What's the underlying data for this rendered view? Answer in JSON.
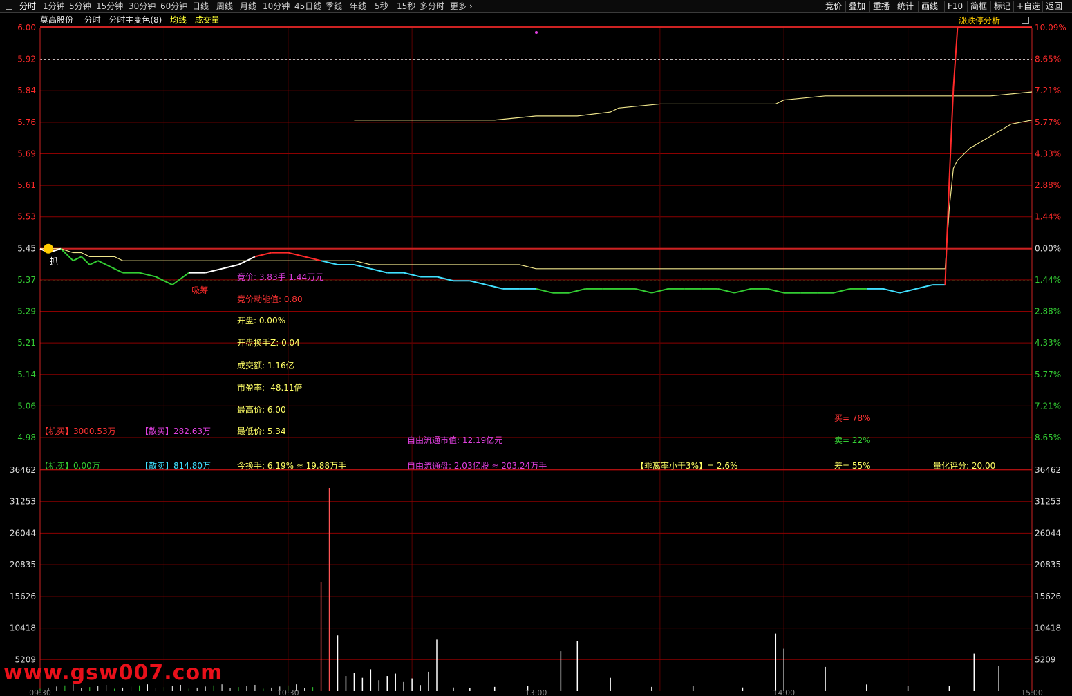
{
  "toolbar": {
    "tabs": [
      "分时",
      "1分钟",
      "5分钟",
      "15分钟",
      "30分钟",
      "60分钟",
      "日线",
      "周线",
      "月线",
      "10分钟",
      "45日线",
      "季线",
      "年线",
      "5秒",
      "15秒",
      "多分时",
      "更多"
    ],
    "active_tab": "分时",
    "right_buttons": [
      "竞价",
      "叠加",
      "重播",
      "统计",
      "画线",
      "F10",
      "简框",
      "标记",
      "+自选",
      "返回"
    ]
  },
  "header": {
    "stock_name": "莫高股份",
    "view": "分时",
    "indicator": "分时主变色(8)",
    "avg_label": "均线",
    "vol_label": "成交量",
    "analysis_button": "涨跌停分析"
  },
  "colors": {
    "up": "#ff2a2a",
    "down": "#33cc33",
    "price_line": "#ffffff",
    "avg_line": "#f0e68c",
    "grid": "#8b0000",
    "magenta": "#e040e0",
    "yellow": "#ffff66",
    "cyan": "#40e0ff"
  },
  "chart_data": [
    {
      "type": "line",
      "title": "分时",
      "y_ticks": [
        "6.00",
        "5.92",
        "5.84",
        "5.76",
        "5.69",
        "5.61",
        "5.53",
        "5.45",
        "5.37",
        "5.29",
        "5.21",
        "5.14",
        "5.06",
        "4.98"
      ],
      "pct_ticks": [
        "10.09%",
        "8.65%",
        "7.21%",
        "5.77%",
        "4.33%",
        "2.88%",
        "1.44%",
        "0.00%",
        "1.44%",
        "2.88%",
        "4.33%",
        "5.77%",
        "7.21%",
        "8.65%"
      ],
      "ylim": [
        4.98,
        6.0
      ],
      "prev_close": 5.45,
      "x": [
        0,
        2,
        5,
        8,
        10,
        12,
        14,
        16,
        18,
        20,
        24,
        28,
        32,
        36,
        40,
        44,
        48,
        52,
        56,
        60,
        64,
        68,
        72,
        76,
        80,
        84,
        88,
        92,
        96,
        100,
        104,
        108,
        112,
        116,
        120,
        124,
        128,
        132,
        136,
        140,
        144,
        148,
        152,
        156,
        160,
        164,
        168,
        172,
        176,
        180,
        184,
        188,
        192,
        196,
        200,
        204,
        208,
        212,
        216,
        219,
        220,
        221,
        222,
        225,
        230,
        235,
        240
      ],
      "series": [
        {
          "name": "价格",
          "values": [
            5.45,
            5.44,
            5.45,
            5.42,
            5.43,
            5.41,
            5.42,
            5.41,
            5.4,
            5.39,
            5.39,
            5.38,
            5.36,
            5.39,
            5.39,
            5.4,
            5.41,
            5.43,
            5.44,
            5.44,
            5.43,
            5.42,
            5.41,
            5.41,
            5.4,
            5.39,
            5.39,
            5.38,
            5.38,
            5.37,
            5.37,
            5.36,
            5.35,
            5.35,
            5.35,
            5.34,
            5.34,
            5.35,
            5.35,
            5.35,
            5.35,
            5.34,
            5.35,
            5.35,
            5.35,
            5.35,
            5.34,
            5.35,
            5.35,
            5.34,
            5.34,
            5.34,
            5.34,
            5.35,
            5.35,
            5.35,
            5.34,
            5.35,
            5.36,
            5.36,
            5.62,
            5.85,
            6.0,
            6.0,
            6.0,
            6.0,
            6.0
          ]
        },
        {
          "name": "均线",
          "values": [
            5.45,
            5.45,
            5.45,
            5.44,
            5.44,
            5.43,
            5.43,
            5.43,
            5.43,
            5.42,
            5.42,
            5.42,
            5.42,
            5.42,
            5.42,
            5.42,
            5.42,
            5.42,
            5.42,
            5.42,
            5.42,
            5.42,
            5.42,
            5.42,
            5.41,
            5.41,
            5.41,
            5.41,
            5.41,
            5.41,
            5.41,
            5.41,
            5.41,
            5.41,
            5.4,
            5.4,
            5.4,
            5.4,
            5.4,
            5.4,
            5.4,
            5.4,
            5.4,
            5.4,
            5.4,
            5.4,
            5.4,
            5.4,
            5.4,
            5.4,
            5.4,
            5.4,
            5.4,
            5.4,
            5.4,
            5.4,
            5.4,
            5.4,
            5.4,
            5.4,
            5.55,
            5.65,
            5.67,
            5.7,
            5.73,
            5.76,
            5.77
          ]
        }
      ],
      "avg_after": {
        "x": [
          76,
          90,
          100,
          110,
          120,
          130,
          138,
          140,
          150,
          160,
          170,
          178,
          180,
          190,
          200,
          210,
          220,
          226,
          230,
          240
        ],
        "values": [
          5.77,
          5.77,
          5.77,
          5.77,
          5.78,
          5.78,
          5.79,
          5.8,
          5.81,
          5.81,
          5.81,
          5.81,
          5.82,
          5.83,
          5.83,
          5.83,
          5.83,
          5.83,
          5.83,
          5.84
        ]
      },
      "annotations": [
        "抓",
        "吸筹"
      ]
    },
    {
      "type": "bar",
      "title": "成交量",
      "y_ticks": [
        "36462",
        "31253",
        "26044",
        "20835",
        "15626",
        "10418",
        "5209"
      ],
      "ylim": [
        0,
        36462
      ],
      "x": [
        68,
        70,
        72,
        74,
        76,
        78,
        80,
        82,
        84,
        86,
        88,
        90,
        92,
        94,
        96,
        100,
        104,
        110,
        118,
        126,
        130,
        138,
        148,
        158,
        170,
        178,
        180,
        190,
        200,
        210,
        220,
        226,
        232
      ],
      "values": [
        18000,
        33500,
        9200,
        2500,
        3000,
        2200,
        3600,
        1800,
        2500,
        2900,
        1500,
        2100,
        1000,
        3200,
        8500,
        600,
        500,
        700,
        800,
        6600,
        8300,
        2200,
        700,
        800,
        600,
        9500,
        7000,
        4000,
        1100,
        900,
        800,
        6200,
        4200
      ]
    }
  ],
  "info": {
    "auction_price": "竞价: 3.83手 1.44万元",
    "auction_momentum": "竞价动能值: 0.80",
    "open": "开盘: 0.00%",
    "open_turnover": "开盘换手Z: 0.04",
    "turnover_amount": "成交额: 1.16亿",
    "pe": "市盈率: -48.11倍",
    "high": "最高价: 6.00",
    "low": "最低价: 5.34",
    "inst_buy": "【机买】3000.53万",
    "retail_buy": "【散买】282.63万",
    "inst_sell": "【机卖】0.00万",
    "retail_sell": "【散卖】814.80万",
    "today_turnover": "今换手: 6.19% ≈ 19.88万手",
    "free_float_value": "自由流通市值: 12.19亿元",
    "free_float_shares": "自由流通盘: 2.03亿股 ≈ 203.24万手",
    "deviation": "【乖离率小于3%】= 2.6%",
    "buy_pct": "买= 78%",
    "sell_pct": "卖= 22%",
    "diff_pct": "差= 55%",
    "quant_score": "量化评分: 20.00"
  },
  "time_axis": [
    "09:30",
    "10:30",
    "13:00",
    "14:00",
    "15:00"
  ],
  "watermark": "www.gsw007.com"
}
